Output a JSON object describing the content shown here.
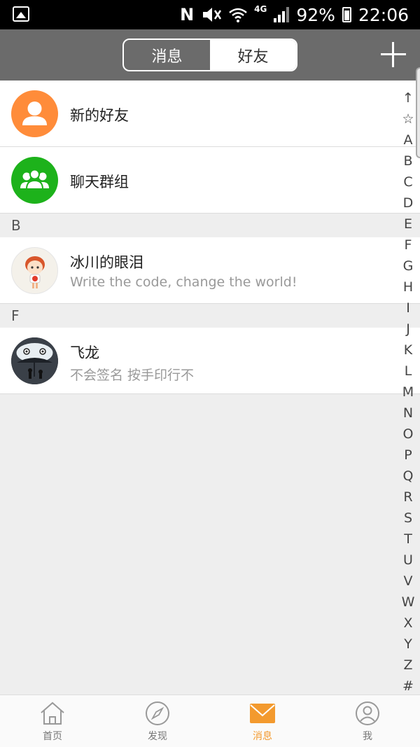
{
  "status_bar": {
    "network": "4G",
    "battery": "92%",
    "time": "22:06"
  },
  "header": {
    "tabs": [
      {
        "label": "消息"
      },
      {
        "label": "好友"
      }
    ],
    "active_tab": "好友"
  },
  "friends": {
    "fixed_items": [
      {
        "label": "新的好友",
        "color": "#ff8c3a",
        "icon": "person-icon"
      },
      {
        "label": "聊天群组",
        "color": "#1db21b",
        "icon": "group-icon"
      }
    ],
    "sections": [
      {
        "letter": "B",
        "contacts": [
          {
            "name": "冰川的眼泪",
            "signature": "Write the code, change the world!",
            "avatar": "cartoon-boy-avatar"
          }
        ]
      },
      {
        "letter": "F",
        "contacts": [
          {
            "name": "飞龙",
            "signature": "不会签名 按手印行不",
            "avatar": "totoro-avatar"
          }
        ]
      }
    ]
  },
  "index_bar": [
    "↑",
    "☆",
    "A",
    "B",
    "C",
    "D",
    "E",
    "F",
    "G",
    "H",
    "I",
    "J",
    "K",
    "L",
    "M",
    "N",
    "O",
    "P",
    "Q",
    "R",
    "S",
    "T",
    "U",
    "V",
    "W",
    "X",
    "Y",
    "Z",
    "#"
  ],
  "bottom_nav": [
    {
      "label": "首页",
      "icon": "home-icon"
    },
    {
      "label": "发现",
      "icon": "compass-icon"
    },
    {
      "label": "消息",
      "icon": "mail-icon"
    },
    {
      "label": "我",
      "icon": "profile-icon"
    }
  ],
  "active_nav": "消息",
  "colors": {
    "accent": "#f39a2e",
    "header_bg": "#6b6b6b"
  }
}
